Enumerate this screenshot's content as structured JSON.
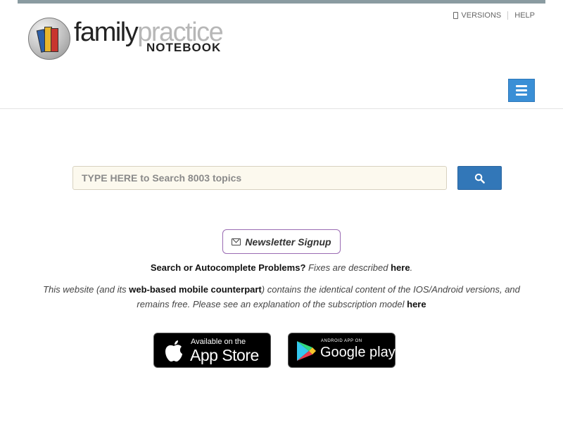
{
  "brand": {
    "word_family": "family",
    "word_practice": "practice",
    "word_notebook": "NOTEBOOK"
  },
  "topnav": {
    "versions": "VERSIONS",
    "help": "HELP"
  },
  "search": {
    "placeholder": "TYPE HERE to Search 8003 topics",
    "value": ""
  },
  "newsletter": {
    "label": "Newsletter Signup"
  },
  "autocomplete_notice": {
    "lead": "Search or Autocomplete Problems?",
    "mid": "Fixes are described",
    "link": "here",
    "tail": "."
  },
  "mobile_notice": {
    "part1": "This website (and its",
    "link1": "web-based mobile counterpart",
    "part2": ") contains the identical content of the IOS/Android versions, and remains free. Please see an explanation of the subscription model",
    "link2": "here"
  },
  "badges": {
    "appstore_small": "Available on the",
    "appstore_large": "App Store",
    "google_small": "ANDROID APP ON",
    "google_large": "Google play"
  },
  "icons": {
    "menu": "hamburger-icon",
    "search": "search-icon",
    "envelope": "envelope-icon",
    "phone": "phone-icon",
    "apple": "apple-icon",
    "play": "google-play-icon"
  },
  "colors": {
    "topbar": "#8a9ba1",
    "menu_button": "#3a8fd6",
    "search_button": "#3277b8",
    "newsletter_border": "#9a6bb3",
    "search_field_bg": "#fcf9ee"
  }
}
